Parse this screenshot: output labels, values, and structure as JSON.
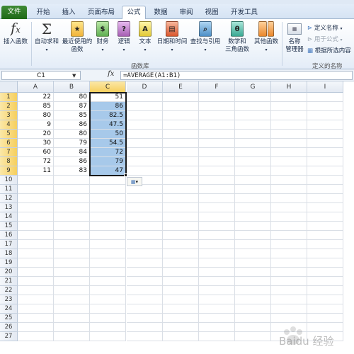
{
  "ribbon_tabs": [
    "文件",
    "开始",
    "插入",
    "页面布局",
    "公式",
    "数据",
    "审阅",
    "视图",
    "开发工具"
  ],
  "ribbon": {
    "insert_function": "插入函数",
    "autosum": "自动求和",
    "recent_1": "最近使用的",
    "recent_2": "函数",
    "financial": "财务",
    "logical": "逻辑",
    "text": "文本",
    "datetime": "日期和时间",
    "lookup": "查找与引用",
    "math_1": "数学和",
    "math_2": "三角函数",
    "more": "其他函数",
    "group_library": "函数库",
    "name_mgr_1": "名称",
    "name_mgr_2": "管理器",
    "define_name": "定义名称",
    "use_in_formula": "用于公式",
    "create_from_sel": "根据所选内容",
    "group_names": "定义的名称"
  },
  "formula_bar": {
    "name_box": "C1",
    "fx": "fx",
    "formula": "=AVERAGE(A1:B1)"
  },
  "columns": [
    "A",
    "B",
    "C",
    "D",
    "E",
    "F",
    "G",
    "H",
    "I"
  ],
  "rows": [
    "1",
    "2",
    "3",
    "4",
    "5",
    "6",
    "7",
    "8",
    "9",
    "10",
    "11",
    "12",
    "13",
    "14",
    "15",
    "16",
    "17",
    "18",
    "19",
    "20",
    "21",
    "22",
    "23",
    "24",
    "25",
    "26",
    "27"
  ],
  "sheet": {
    "A": [
      "22",
      "85",
      "80",
      "9",
      "20",
      "30",
      "60",
      "72",
      "11"
    ],
    "B": [
      "80",
      "87",
      "85",
      "86",
      "80",
      "79",
      "84",
      "86",
      "83"
    ],
    "C": [
      "51",
      "86",
      "82.5",
      "47.5",
      "50",
      "54.5",
      "72",
      "79",
      "47"
    ]
  },
  "watermark": "Baidu 经验",
  "colors": {
    "file_tab": "#2a7a22",
    "selection_fill": "#a7c9ea",
    "header_selected": "#f6cf5e"
  }
}
